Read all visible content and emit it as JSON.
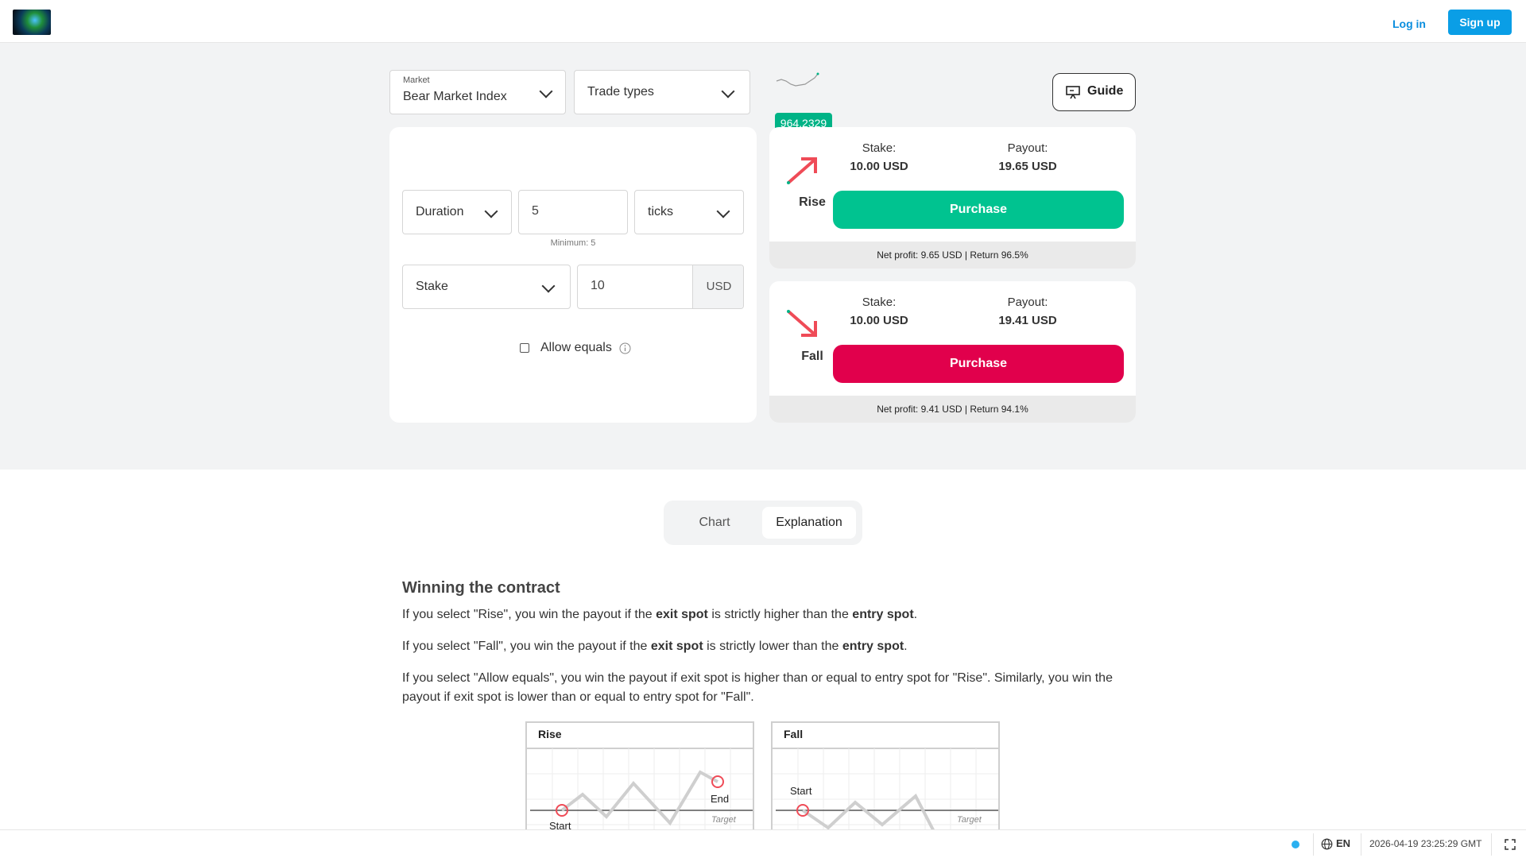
{
  "header": {
    "login_label": "Log in",
    "signup_label": "Sign up"
  },
  "selectors": {
    "market_label": "Market",
    "market_value": "Bear Market Index",
    "trade_types_value": "Trade types"
  },
  "ticker": {
    "spot": "964.2329"
  },
  "guide": {
    "label": "Guide"
  },
  "trade_params": {
    "duration_type": "Duration",
    "duration_value": "5",
    "duration_unit": "ticks",
    "duration_min": "Minimum: 5",
    "stake_type": "Stake",
    "stake_value": "10",
    "stake_currency": "USD",
    "allow_equals_label": "Allow equals",
    "allow_equals_checked": false
  },
  "contracts": {
    "rise": {
      "label": "Rise",
      "stake_label": "Stake:",
      "stake_value": "10.00 USD",
      "payout_label": "Payout:",
      "payout_value": "19.65 USD",
      "purchase_label": "Purchase",
      "footer": "Net profit: 9.65 USD | Return 96.5%",
      "color": "#00c390"
    },
    "fall": {
      "label": "Fall",
      "stake_label": "Stake:",
      "stake_value": "10.00 USD",
      "payout_label": "Payout:",
      "payout_value": "19.41 USD",
      "purchase_label": "Purchase",
      "footer": "Net profit: 9.41 USD | Return 94.1%",
      "color": "#e1004c"
    }
  },
  "tabs": [
    {
      "label": "Chart",
      "active": false
    },
    {
      "label": "Explanation",
      "active": true
    }
  ],
  "explanation": {
    "heading": "Winning the contract",
    "p1": {
      "a": "If you select \"Rise\", you win the payout if the ",
      "b1": "exit spot",
      "c": " is strictly higher than the ",
      "b2": "entry spot",
      "d": "."
    },
    "p2": {
      "a": "If you select \"Fall\", you win the payout if the ",
      "b1": "exit spot",
      "c": " is strictly lower than the ",
      "b2": "entry spot",
      "d": "."
    },
    "p3": "If you select \"Allow equals\", you win the payout if exit spot is higher than or equal to entry spot for \"Rise\". Similarly, you win the payout if exit spot is lower than or equal to entry spot for \"Fall\".",
    "diagram_rise": {
      "title": "Rise",
      "start": "Start",
      "end": "End",
      "target": "Target"
    },
    "diagram_fall": {
      "title": "Fall",
      "start": "Start",
      "target": "Target"
    }
  },
  "statusbar": {
    "language": "EN",
    "datetime": "2026-04-19 23:25:29 GMT"
  },
  "icons": {
    "rise_arrow": "arrow-up-right-icon",
    "fall_arrow": "arrow-down-right-icon",
    "guide": "presentation-icon",
    "info": "info-icon",
    "globe": "globe-icon",
    "fullscreen": "fullscreen-icon"
  }
}
